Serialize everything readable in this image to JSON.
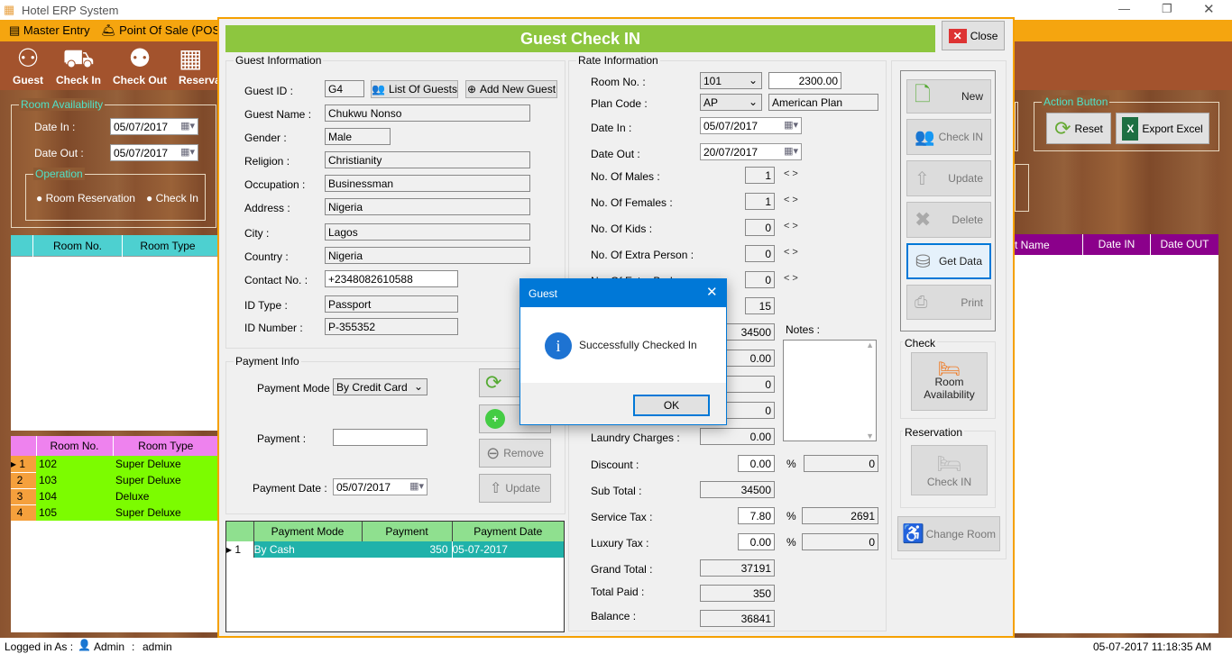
{
  "window": {
    "title": "Hotel ERP System",
    "controls": [
      "minimize",
      "restore",
      "close"
    ]
  },
  "menu": {
    "items": [
      {
        "label": "Master Entry",
        "icon": "ledger-icon"
      },
      {
        "label": "Point Of Sale (POS)",
        "icon": "bell-icon"
      }
    ]
  },
  "toolbar": {
    "items": [
      {
        "label": "Guest"
      },
      {
        "label": "Check In"
      },
      {
        "label": "Check Out"
      },
      {
        "label": "Reservat"
      }
    ]
  },
  "sidebar": {
    "room_availability": {
      "title": "Room Availability",
      "date_in_label": "Date In :",
      "date_in": "05/07/2017",
      "date_out_label": "Date Out :",
      "date_out": "05/07/2017"
    },
    "operation": {
      "title": "Operation",
      "options": [
        "Room Reservation",
        "Check In"
      ]
    },
    "room_table": {
      "headers": [
        "Room No.",
        "Room Type"
      ]
    },
    "rooms_table": {
      "headers": [
        "Room No.",
        "Room Type"
      ],
      "rows": [
        [
          "1",
          "102",
          "Super Deluxe"
        ],
        [
          "2",
          "103",
          "Super Deluxe"
        ],
        [
          "3",
          "104",
          "Deluxe"
        ],
        [
          "4",
          "105",
          "Super Deluxe"
        ]
      ]
    }
  },
  "right_panel": {
    "action_title": "Action Button",
    "reset": "Reset",
    "export": "Export Excel",
    "table_headers": [
      "t Name",
      "Date IN",
      "Date OUT"
    ]
  },
  "form": {
    "title": "Guest Check IN",
    "close": "Close",
    "guest_info": {
      "title": "Guest Information",
      "guest_id_label": "Guest ID :",
      "guest_id": "G4",
      "list_guests": "List Of Guests",
      "add_guest": "Add New Guest",
      "fields": [
        {
          "label": "Guest Name :",
          "value": "Chukwu Nonso"
        },
        {
          "label": "Gender :",
          "value": "Male"
        },
        {
          "label": "Religion :",
          "value": "Christianity"
        },
        {
          "label": "Occupation :",
          "value": "Businessman"
        },
        {
          "label": "Address :",
          "value": "Nigeria"
        },
        {
          "label": "City :",
          "value": "Lagos"
        },
        {
          "label": "Country :",
          "value": "Nigeria"
        },
        {
          "label": "Contact No. :",
          "value": "+2348082610588"
        },
        {
          "label": "ID Type :",
          "value": "Passport"
        },
        {
          "label": "ID Number :",
          "value": "P-355352"
        }
      ]
    },
    "payment_info": {
      "title": "Payment Info",
      "mode_label": "Payment Mode :",
      "mode": "By Credit Card",
      "payment_label": "Payment :",
      "payment": "",
      "date_label": "Payment Date :",
      "date": "05/07/2017",
      "remove": "Remove",
      "update": "Update"
    },
    "payment_table": {
      "headers": [
        "Payment Mode",
        "Payment",
        "Payment Date"
      ],
      "rows": [
        [
          "1",
          "By Cash",
          "350",
          "05-07-2017"
        ]
      ]
    },
    "rate_info": {
      "title": "Rate Information",
      "room_no_label": "Room No. :",
      "room_no": "101",
      "rate": "2300.00",
      "plan_label": "Plan Code :",
      "plan": "AP",
      "plan_name": "American Plan",
      "date_in_label": "Date In :",
      "date_in": "05/07/2017",
      "date_out_label": "Date Out :",
      "date_out": "20/07/2017",
      "rows": [
        {
          "label": "No. Of Males :",
          "value": "1"
        },
        {
          "label": "No. Of Females :",
          "value": "1"
        },
        {
          "label": "No. Of Kids :",
          "value": "0"
        },
        {
          "label": "No. Of Extra Person :",
          "value": "0"
        },
        {
          "label": "No. Of Extra Bed :",
          "value": "0"
        },
        {
          "label": "",
          "value": "15"
        },
        {
          "label": "",
          "value": "34500"
        },
        {
          "label": "",
          "value": "0.00"
        },
        {
          "label": "",
          "value": "0"
        },
        {
          "label": "",
          "value": "0"
        },
        {
          "label": "Laundry Charges :",
          "value": "0.00"
        }
      ],
      "notes_label": "Notes :",
      "discount_label": "Discount :",
      "discount": "0.00",
      "discount_amt": "0",
      "subtotal_label": "Sub Total :",
      "subtotal": "34500",
      "service_tax_label": "Service Tax :",
      "service_tax": "7.80",
      "service_tax_amt": "2691",
      "luxury_tax_label": "Luxury Tax :",
      "luxury_tax": "0.00",
      "luxury_tax_amt": "0",
      "percent": "%",
      "grand_total_label": "Grand Total :",
      "grand_total": "37191",
      "total_paid_label": "Total Paid :",
      "total_paid": "350",
      "balance_label": "Balance :",
      "balance": "36841"
    },
    "actions": {
      "new": "New",
      "check_in": "Check IN",
      "update": "Update",
      "delete": "Delete",
      "get_data": "Get Data",
      "print": "Print",
      "check_title": "Check",
      "room_availability": "Room Availability",
      "reservation_title": "Reservation",
      "res_check_in": "Check IN",
      "change_room": "Change Room"
    }
  },
  "dialog": {
    "title": "Guest",
    "message": "Successfully Checked In",
    "ok": "OK",
    "icon": "info-icon"
  },
  "status": {
    "logged_label": "Logged in As :",
    "user_role": "Admin",
    "sep": ":",
    "username": "admin",
    "datetime": "05-07-2017 11:18:35 AM"
  },
  "colors": {
    "accent_orange": "#f5a50f",
    "header_green": "#8dc63f",
    "teal": "#4dd0d0",
    "pink": "#ee82ee",
    "row_green": "#7cfc00",
    "purple": "#8b008b",
    "dialog_blue": "#0078d7"
  }
}
